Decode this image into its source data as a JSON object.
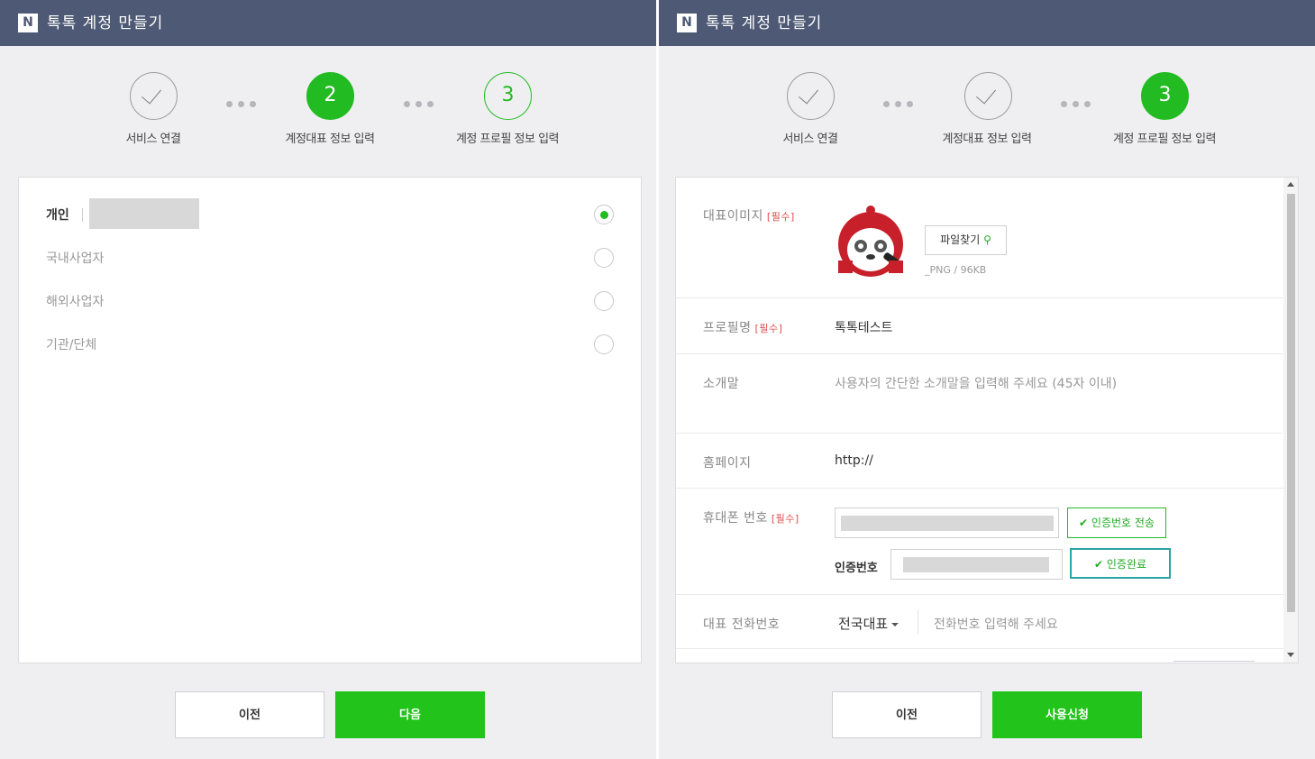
{
  "app_title": "톡톡 계정 만들기",
  "logo_letter": "N",
  "steps": [
    {
      "label": "서비스 연결"
    },
    {
      "label": "계정대표 정보 입력",
      "number": "2"
    },
    {
      "label": "계정 프로필 정보 입력",
      "number": "3"
    }
  ],
  "left": {
    "options": [
      {
        "label": "개인",
        "selected": true
      },
      {
        "label": "국내사업자",
        "selected": false
      },
      {
        "label": "해외사업자",
        "selected": false
      },
      {
        "label": "기관/단체",
        "selected": false
      }
    ],
    "prev_label": "이전",
    "next_label": "다음"
  },
  "right": {
    "fields": {
      "image_label": "대표이미지",
      "required_tag": "[필수]",
      "file_button": "파일찾기",
      "file_note": "_PNG / 96KB",
      "profile_label": "프로필명",
      "profile_value": "톡톡테스트",
      "intro_label": "소개말",
      "intro_placeholder": "사용자의 간단한 소개말을 입력해 주세요 (45자 이내)",
      "homepage_label": "홈페이지",
      "homepage_value": "http://",
      "phone_label": "휴대폰 번호",
      "send_code_button": "인증번호 전송",
      "code_label": "인증번호",
      "verify_button": "인증완료",
      "tel_label": "대표 전화번호",
      "tel_select": "전국대표",
      "tel_placeholder": "전화번호 입력해 주세요"
    },
    "prev_label": "이전",
    "submit_label": "사용신청"
  },
  "colors": {
    "header": "#4e5a75",
    "accent": "#22bb22",
    "required": "#e14b4b"
  }
}
